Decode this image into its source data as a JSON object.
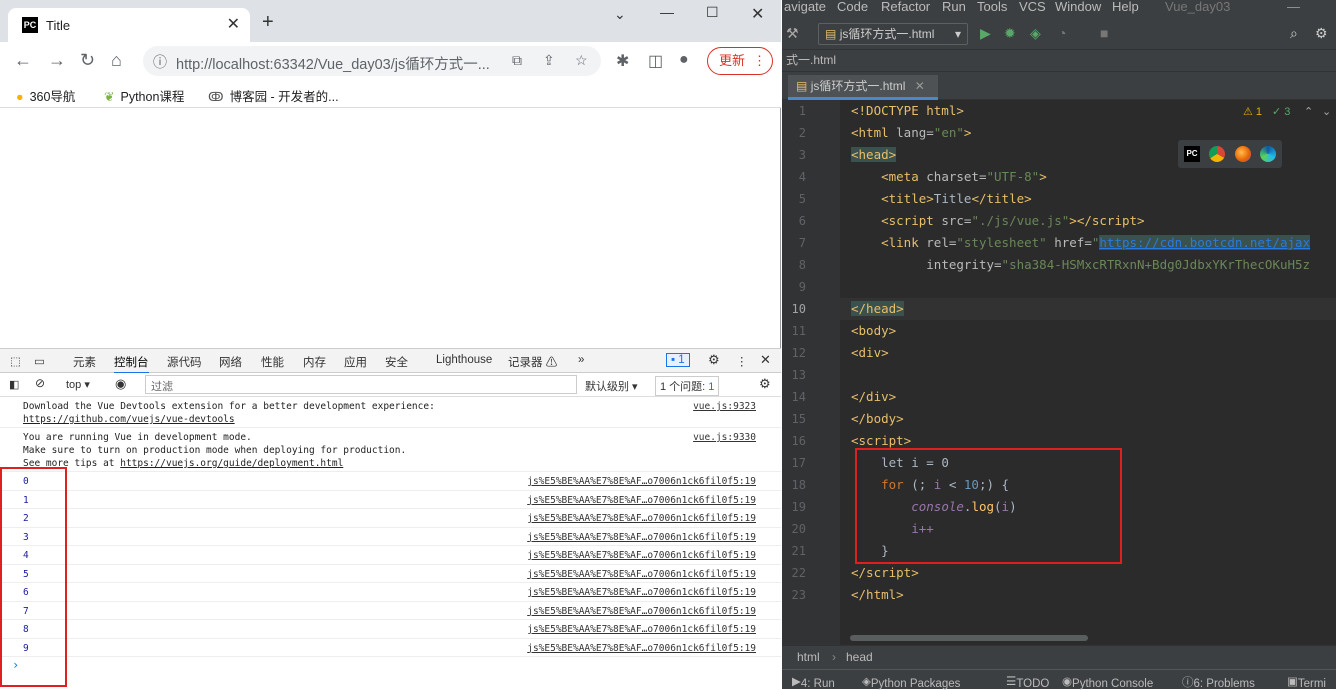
{
  "browser": {
    "tab_title": "Title",
    "favicon_text": "PC",
    "url": "http://localhost:63342/Vue_day03/js循环方式一...",
    "update_label": "更新",
    "bookmarks": [
      "360导航",
      "Python课程",
      "博客园 - 开发者的..."
    ]
  },
  "devtools": {
    "tabs": [
      "元素",
      "控制台",
      "源代码",
      "网络",
      "性能",
      "内存",
      "应用",
      "安全",
      "Lighthouse",
      "记录器 ⚠",
      "»"
    ],
    "active_tab": "控制台",
    "issue_badge": "1",
    "context": "top",
    "filter_placeholder": "过滤",
    "levels": "默认级别",
    "issues": "1 个问题:",
    "issues_count": "1",
    "messages": [
      {
        "lines": [
          "Download the Vue Devtools extension for a better development experience:"
        ],
        "link": "https://github.com/vuejs/vue-devtools",
        "source": "vue.js:9323"
      },
      {
        "lines": [
          "You are running Vue in development mode.",
          "Make sure to turn on production mode when deploying for production."
        ],
        "link_prefix": "See more tips at ",
        "link": "https://vuejs.org/guide/deployment.html",
        "source": "vue.js:9330"
      }
    ],
    "log_values": [
      "0",
      "1",
      "2",
      "3",
      "4",
      "5",
      "6",
      "7",
      "8",
      "9"
    ],
    "log_source": "js%E5%BE%AA%E7%8E%AF…o7006n1ck6fil0f5:19",
    "prompt": "›"
  },
  "ide": {
    "menu": [
      "avigate",
      "Code",
      "Refactor",
      "Run",
      "Tools",
      "VCS",
      "Window",
      "Help",
      "Vue_day03"
    ],
    "run_config": "js循环方式一.html",
    "crumb": "式一.html",
    "editor_tab": "js循环方式一.html",
    "warnings": "1",
    "checks": "3",
    "line_numbers": [
      "1",
      "2",
      "3",
      "4",
      "5",
      "6",
      "7",
      "8",
      "9",
      "10",
      "11",
      "12",
      "13",
      "14",
      "15",
      "16",
      "17",
      "18",
      "19",
      "20",
      "21",
      "22",
      "23"
    ],
    "code": {
      "l1": "<!DOCTYPE html>",
      "l2_lang": "en",
      "l4_charset": "UTF-8",
      "l5_title": "Title",
      "l6_src": "./js/vue.js",
      "l7_rel": "stylesheet",
      "l7_href": "https://cdn.bootcdn.net/ajax",
      "l8_integrity": "sha384-HSMxcRTRxnN+Bdg0JdbxYKrThecOKuH5z",
      "l17": "let i = 0",
      "l18_num": "10",
      "l19_obj": "console",
      "l19_fn": "log",
      "l20": "i++"
    },
    "breadcrumb": [
      "html",
      "head"
    ],
    "status": [
      "4: Run",
      "Python Packages",
      "TODO",
      "Python Console",
      "6: Problems",
      "Termi"
    ]
  }
}
